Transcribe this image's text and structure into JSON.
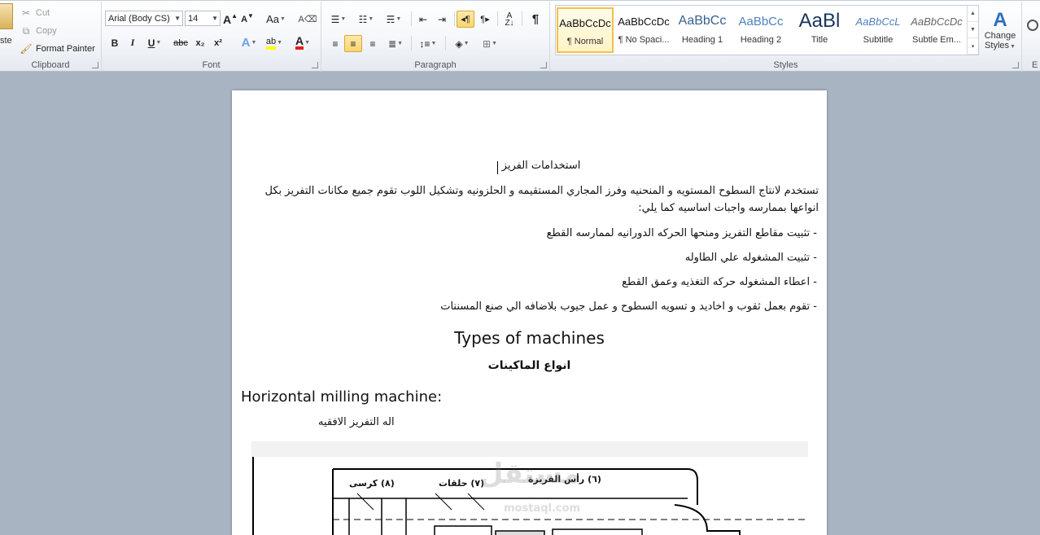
{
  "clipboard": {
    "paste_label": "ste",
    "cut_label": "Cut",
    "copy_label": "Copy",
    "format_painter_label": "Format Painter",
    "group_label": "Clipboard"
  },
  "font": {
    "family_value": "Arial (Body CS)",
    "size_value": "14",
    "group_label": "Font",
    "change_case_label": "Aa",
    "grow_label": "A",
    "shrink_label": "A",
    "bold": "B",
    "italic": "I",
    "underline": "U",
    "strike": "abc",
    "subscript": "x₂",
    "superscript": "x²",
    "highlight_glyph": "ab",
    "color_glyph": "A",
    "text_effects_glyph": "A"
  },
  "paragraph": {
    "group_label": "Paragraph",
    "pilcrow": "¶"
  },
  "styles": {
    "group_label": "Styles",
    "items": [
      {
        "preview": "AaBbCcDc",
        "name": "¶ Normal"
      },
      {
        "preview": "AaBbCcDc",
        "name": "¶ No Spaci..."
      },
      {
        "preview": "AaBbCc",
        "name": "Heading 1"
      },
      {
        "preview": "AaBbCc",
        "name": "Heading 2"
      },
      {
        "preview": "AaBl",
        "name": "Title"
      },
      {
        "preview": "AaBbCcL",
        "name": "Subtitle"
      },
      {
        "preview": "AaBbCcDc",
        "name": "Subtle Em..."
      }
    ],
    "change_styles_line1": "Change",
    "change_styles_line2": "Styles"
  },
  "editing": {
    "fragment_label": "E"
  },
  "document": {
    "heading1": "استخدامات الفريز",
    "intro_line1": "تستخدم لانتاج السطوح المستويه و المنحنيه وفرز المجاري المستقيمه و الحلزونيه وتشكيل اللوب تقوم جميع مكانات التفريز بكل",
    "intro_line2": "انواعها بممارسه واجبات اساسيه كما يلي:",
    "bullets": [
      "- تثبيت مقاطع التفريز ومنحها الحركه الدورانيه لممارسه القطع",
      "- تثبيت المشغوله علي الطاوله",
      "- اعطاء المشغوله حركه التغذيه وعمق القطع",
      "- تقوم بعمل ثقوب و اخاديد و تسويه السطوح و عمل جيوب بلاضافه الي صنع المسننات"
    ],
    "types_en": "Types of machines",
    "types_ar": "انواع الماكينات",
    "horizontal_en": "Horizontal milling machine:",
    "horizontal_ar": "اله التفريز الافقيه",
    "diagram_labels": [
      "(٦) رأس الفريزة",
      "(٧) حلقات",
      "(٨) كرسى"
    ],
    "watermark": "مستقل",
    "watermark_url": "mostaql.com"
  }
}
